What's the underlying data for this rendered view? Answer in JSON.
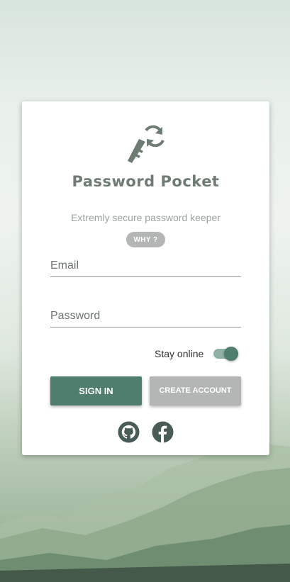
{
  "app": {
    "brand": "Password Pocket",
    "tagline": "Extremly secure password keeper",
    "why_label": "WHY ?"
  },
  "form": {
    "email_placeholder": "Email",
    "password_placeholder": "Password",
    "stay_online_label": "Stay online",
    "stay_online": true,
    "signin_label": "SIGN IN",
    "create_label": "CREATE ACCOUNT"
  },
  "social": [
    "github-icon",
    "facebook-icon"
  ],
  "colors": {
    "accent": "#4f7e6f",
    "secondary_button": "#b3b6b4",
    "brand_text": "#6f7c74",
    "icon": "#4a5c58"
  }
}
